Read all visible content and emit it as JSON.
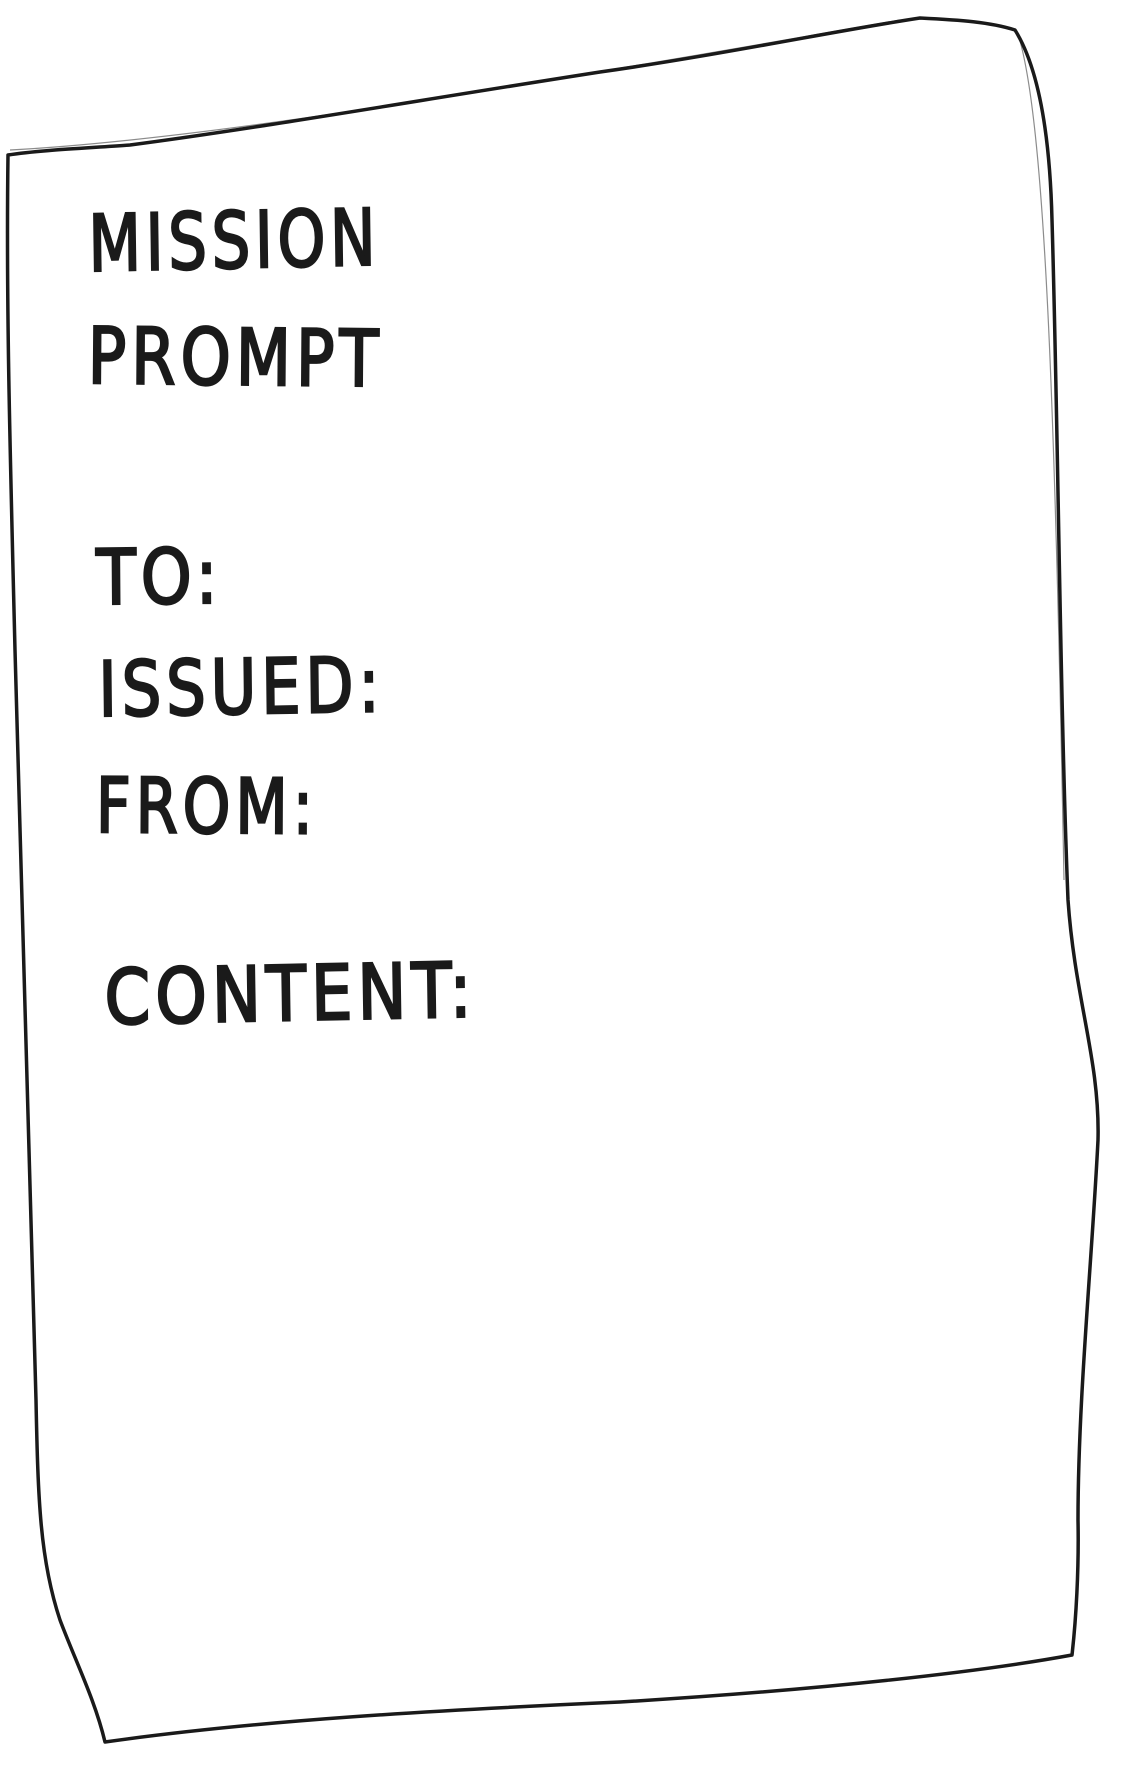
{
  "document": {
    "title_line_1": "MISSION",
    "title_line_2": "PROMPT",
    "fields": {
      "to": "TO:",
      "issued": "ISSUED:",
      "from": "FROM:",
      "content": "CONTENT:"
    }
  },
  "colors": {
    "ink": "#1a1a1a",
    "paper": "#ffffff"
  }
}
